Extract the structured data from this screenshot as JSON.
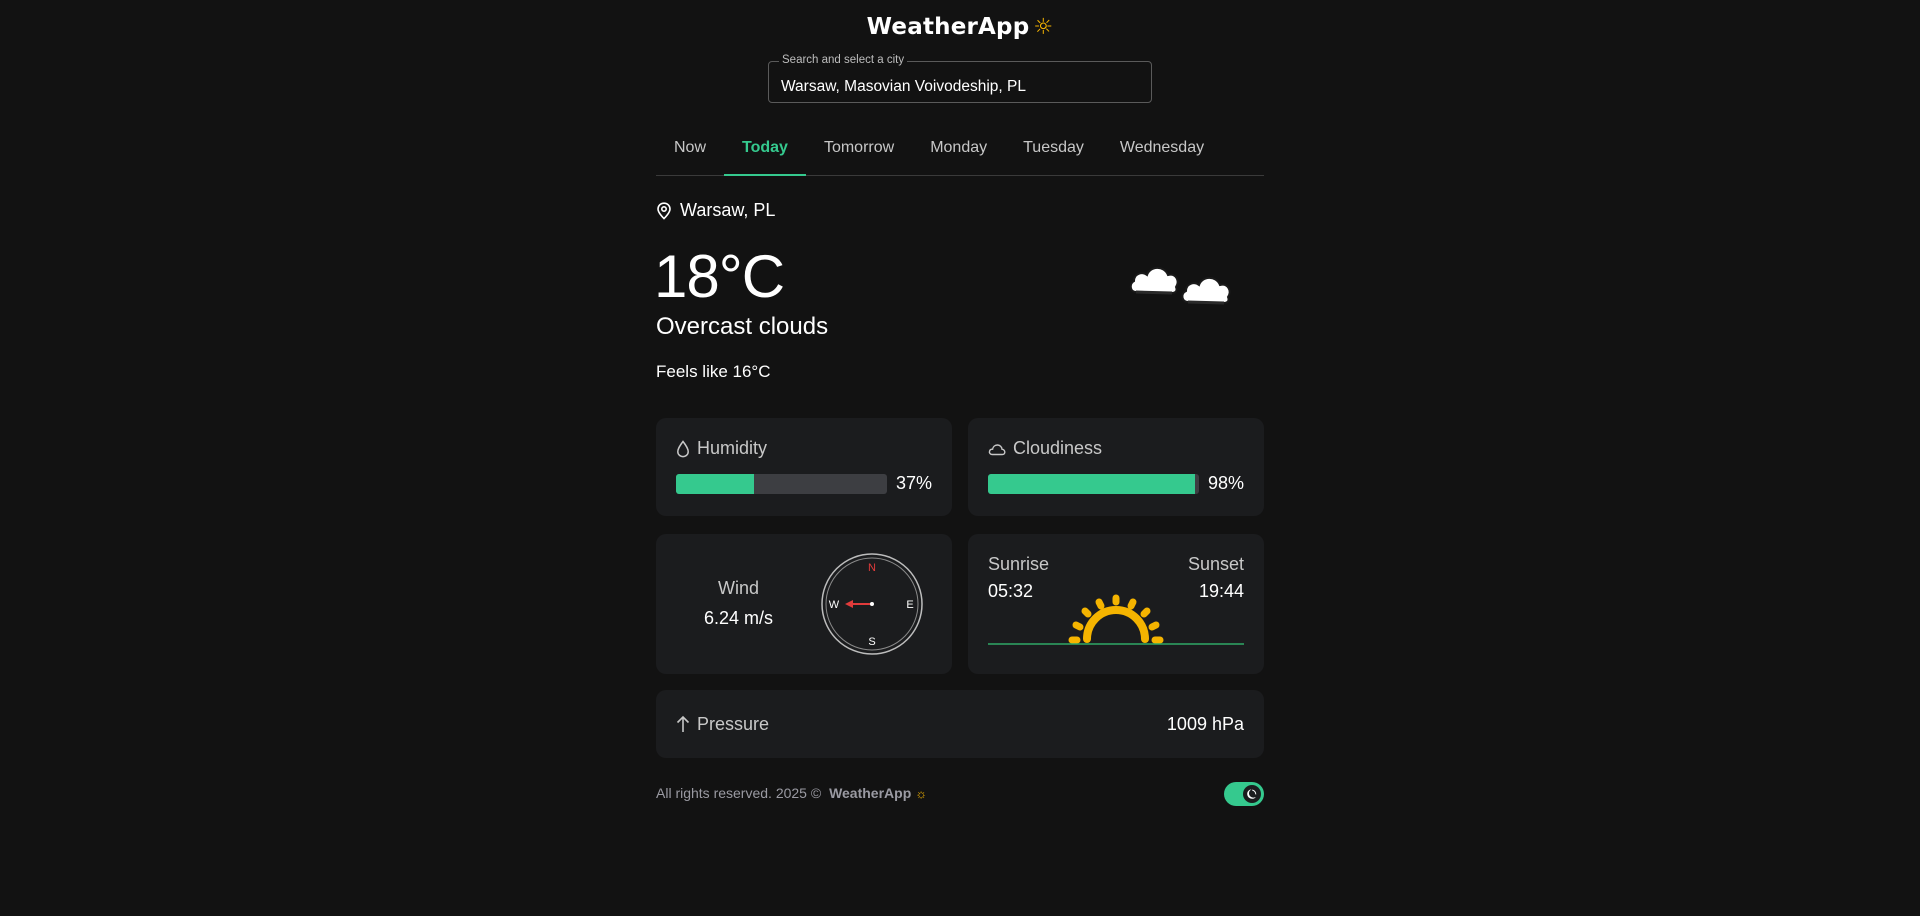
{
  "app": {
    "name": "WeatherApp",
    "logo_icon": "sun-icon"
  },
  "search": {
    "legend": "Search and select a city",
    "value": "Warsaw, Masovian Voivodeship, PL"
  },
  "tabs": [
    {
      "label": "Now",
      "active": false
    },
    {
      "label": "Today",
      "active": true
    },
    {
      "label": "Tomorrow",
      "active": false
    },
    {
      "label": "Monday",
      "active": false
    },
    {
      "label": "Tuesday",
      "active": false
    },
    {
      "label": "Wednesday",
      "active": false
    }
  ],
  "current": {
    "location": "Warsaw, PL",
    "temperature": "18°C",
    "description": "Overcast clouds",
    "feels_like": "Feels like 16°C",
    "icon": "clouds-icon"
  },
  "humidity": {
    "label": "Humidity",
    "value_text": "37%",
    "value": 37
  },
  "cloudiness": {
    "label": "Cloudiness",
    "value_text": "98%",
    "value": 98
  },
  "wind": {
    "label": "Wind",
    "speed": "6.24 m/s",
    "compass": {
      "n": "N",
      "e": "E",
      "s": "S",
      "w": "W"
    },
    "direction_deg": 270
  },
  "sun": {
    "sunrise_label": "Sunrise",
    "sunrise": "05:32",
    "sunset_label": "Sunset",
    "sunset": "19:44"
  },
  "pressure": {
    "label": "Pressure",
    "value": "1009 hPa"
  },
  "footer": {
    "text": "All rights reserved. 2025 © ",
    "brand": "WeatherApp"
  },
  "theme": {
    "dark_mode": true
  },
  "colors": {
    "accent": "#35c98e",
    "background": "#121212",
    "card": "#1b1c1e",
    "sun": "#f5b400",
    "compass_north": "#e23b3b"
  }
}
